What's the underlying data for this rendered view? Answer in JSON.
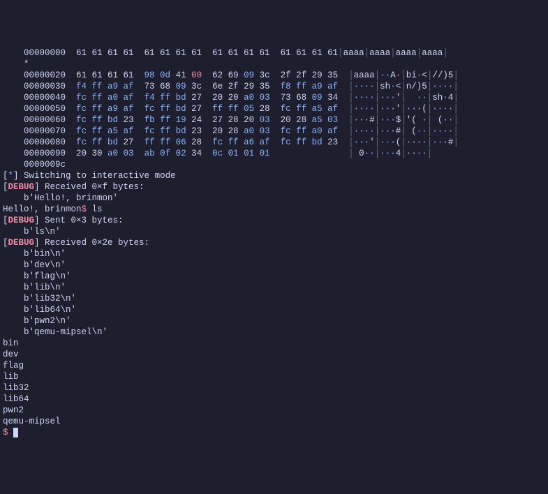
{
  "hex": {
    "rows": [
      {
        "addr": "00000000",
        "spans": [
          {
            "t": "  61 61 61 61  61 61 61 61  61 61 61 61  61 61 61 61",
            "c": "hx"
          }
        ],
        "asc": [
          {
            "t": "│",
            "c": "bar"
          },
          {
            "t": "aaaa",
            "c": "asc"
          },
          {
            "t": "│",
            "c": "bar"
          },
          {
            "t": "aaaa",
            "c": "asc"
          },
          {
            "t": "│",
            "c": "bar"
          },
          {
            "t": "aaaa",
            "c": "asc"
          },
          {
            "t": "│",
            "c": "bar"
          },
          {
            "t": "aaaa",
            "c": "asc"
          },
          {
            "t": "│",
            "c": "bar"
          }
        ]
      },
      {
        "addr": "*",
        "spans": [
          {
            "t": "",
            "c": "hx"
          }
        ],
        "asc": []
      },
      {
        "addr": "00000020",
        "spans": [
          {
            "t": "  61 61 61 61  ",
            "c": "hx"
          },
          {
            "t": "98 0d",
            "c": "c1"
          },
          {
            "t": " 41 ",
            "c": "hx"
          },
          {
            "t": "00",
            "c": "c2"
          },
          {
            "t": "  62 69 ",
            "c": "hx"
          },
          {
            "t": "09",
            "c": "c1"
          },
          {
            "t": " 3c  2f 2f 29 35",
            "c": "hx"
          }
        ],
        "asc": [
          {
            "t": "  │",
            "c": "bar"
          },
          {
            "t": "aaaa",
            "c": "asc"
          },
          {
            "t": "│",
            "c": "bar"
          },
          {
            "t": "··",
            "c": "ascB"
          },
          {
            "t": "A",
            "c": "asc"
          },
          {
            "t": "·",
            "c": "ascR"
          },
          {
            "t": "│",
            "c": "bar"
          },
          {
            "t": "bi",
            "c": "asc"
          },
          {
            "t": "·",
            "c": "ascB"
          },
          {
            "t": "<",
            "c": "asc"
          },
          {
            "t": "│",
            "c": "bar"
          },
          {
            "t": "//)5",
            "c": "asc"
          },
          {
            "t": "│",
            "c": "bar"
          }
        ]
      },
      {
        "addr": "00000030",
        "spans": [
          {
            "t": "  ",
            "c": "hx"
          },
          {
            "t": "f4 ff a9 af",
            "c": "c1"
          },
          {
            "t": "  73 68 ",
            "c": "hx"
          },
          {
            "t": "09",
            "c": "c1"
          },
          {
            "t": " 3c  6e 2f 29 35  ",
            "c": "hx"
          },
          {
            "t": "f8 ff a9 af",
            "c": "c1"
          }
        ],
        "asc": [
          {
            "t": "  │",
            "c": "bar"
          },
          {
            "t": "····",
            "c": "ascB"
          },
          {
            "t": "│",
            "c": "bar"
          },
          {
            "t": "sh",
            "c": "asc"
          },
          {
            "t": "·",
            "c": "ascB"
          },
          {
            "t": "<",
            "c": "asc"
          },
          {
            "t": "│",
            "c": "bar"
          },
          {
            "t": "n/)5",
            "c": "asc"
          },
          {
            "t": "│",
            "c": "bar"
          },
          {
            "t": "····",
            "c": "ascB"
          },
          {
            "t": "│",
            "c": "bar"
          }
        ]
      },
      {
        "addr": "00000040",
        "spans": [
          {
            "t": "  ",
            "c": "hx"
          },
          {
            "t": "fc ff a0 af",
            "c": "c1"
          },
          {
            "t": "  ",
            "c": "hx"
          },
          {
            "t": "f4 ff bd",
            "c": "c1"
          },
          {
            "t": " 27  20 20 ",
            "c": "hx"
          },
          {
            "t": "a0 03",
            "c": "c1"
          },
          {
            "t": "  73 68 ",
            "c": "hx"
          },
          {
            "t": "09",
            "c": "c1"
          },
          {
            "t": " 34",
            "c": "hx"
          }
        ],
        "asc": [
          {
            "t": "  │",
            "c": "bar"
          },
          {
            "t": "····",
            "c": "ascB"
          },
          {
            "t": "│",
            "c": "bar"
          },
          {
            "t": "···",
            "c": "ascB"
          },
          {
            "t": "'",
            "c": "asc"
          },
          {
            "t": "│",
            "c": "bar"
          },
          {
            "t": "  ",
            "c": "asc"
          },
          {
            "t": "··",
            "c": "ascB"
          },
          {
            "t": "│",
            "c": "bar"
          },
          {
            "t": "sh",
            "c": "asc"
          },
          {
            "t": "·",
            "c": "ascB"
          },
          {
            "t": "4",
            "c": "asc"
          },
          {
            "t": "│",
            "c": "bar"
          }
        ]
      },
      {
        "addr": "00000050",
        "spans": [
          {
            "t": "  ",
            "c": "hx"
          },
          {
            "t": "fc ff a9 af",
            "c": "c1"
          },
          {
            "t": "  ",
            "c": "hx"
          },
          {
            "t": "fc ff bd",
            "c": "c1"
          },
          {
            "t": " 27  ",
            "c": "hx"
          },
          {
            "t": "ff ff 05",
            "c": "c1"
          },
          {
            "t": " 28  ",
            "c": "hx"
          },
          {
            "t": "fc ff a5 af",
            "c": "c1"
          }
        ],
        "asc": [
          {
            "t": "  │",
            "c": "bar"
          },
          {
            "t": "····",
            "c": "ascB"
          },
          {
            "t": "│",
            "c": "bar"
          },
          {
            "t": "···",
            "c": "ascB"
          },
          {
            "t": "'",
            "c": "asc"
          },
          {
            "t": "│",
            "c": "bar"
          },
          {
            "t": "···",
            "c": "ascB"
          },
          {
            "t": "(",
            "c": "asc"
          },
          {
            "t": "│",
            "c": "bar"
          },
          {
            "t": "····",
            "c": "ascB"
          },
          {
            "t": "│",
            "c": "bar"
          }
        ]
      },
      {
        "addr": "00000060",
        "spans": [
          {
            "t": "  ",
            "c": "hx"
          },
          {
            "t": "fc ff bd",
            "c": "c1"
          },
          {
            "t": " 23  ",
            "c": "hx"
          },
          {
            "t": "fb ff 19",
            "c": "c1"
          },
          {
            "t": " 24  27 28 20 ",
            "c": "hx"
          },
          {
            "t": "03",
            "c": "c1"
          },
          {
            "t": "  20 28 ",
            "c": "hx"
          },
          {
            "t": "a5 03",
            "c": "c1"
          }
        ],
        "asc": [
          {
            "t": "  │",
            "c": "bar"
          },
          {
            "t": "···",
            "c": "ascB"
          },
          {
            "t": "#",
            "c": "asc"
          },
          {
            "t": "│",
            "c": "bar"
          },
          {
            "t": "···",
            "c": "ascB"
          },
          {
            "t": "$",
            "c": "asc"
          },
          {
            "t": "│",
            "c": "bar"
          },
          {
            "t": "'( ",
            "c": "asc"
          },
          {
            "t": "·",
            "c": "ascB"
          },
          {
            "t": "│",
            "c": "bar"
          },
          {
            "t": " (",
            "c": "asc"
          },
          {
            "t": "··",
            "c": "ascB"
          },
          {
            "t": "│",
            "c": "bar"
          }
        ]
      },
      {
        "addr": "00000070",
        "spans": [
          {
            "t": "  ",
            "c": "hx"
          },
          {
            "t": "fc ff a5 af",
            "c": "c1"
          },
          {
            "t": "  ",
            "c": "hx"
          },
          {
            "t": "fc ff bd",
            "c": "c1"
          },
          {
            "t": " 23  20 28 ",
            "c": "hx"
          },
          {
            "t": "a0 03",
            "c": "c1"
          },
          {
            "t": "  ",
            "c": "hx"
          },
          {
            "t": "fc ff a0 af",
            "c": "c1"
          }
        ],
        "asc": [
          {
            "t": "  │",
            "c": "bar"
          },
          {
            "t": "····",
            "c": "ascB"
          },
          {
            "t": "│",
            "c": "bar"
          },
          {
            "t": "···",
            "c": "ascB"
          },
          {
            "t": "#",
            "c": "asc"
          },
          {
            "t": "│",
            "c": "bar"
          },
          {
            "t": " (",
            "c": "asc"
          },
          {
            "t": "··",
            "c": "ascB"
          },
          {
            "t": "│",
            "c": "bar"
          },
          {
            "t": "····",
            "c": "ascB"
          },
          {
            "t": "│",
            "c": "bar"
          }
        ]
      },
      {
        "addr": "00000080",
        "spans": [
          {
            "t": "  ",
            "c": "hx"
          },
          {
            "t": "fc ff bd",
            "c": "c1"
          },
          {
            "t": " 27  ",
            "c": "hx"
          },
          {
            "t": "ff ff 06",
            "c": "c1"
          },
          {
            "t": " 28  ",
            "c": "hx"
          },
          {
            "t": "fc ff a6 af",
            "c": "c1"
          },
          {
            "t": "  ",
            "c": "hx"
          },
          {
            "t": "fc ff bd",
            "c": "c1"
          },
          {
            "t": " 23",
            "c": "hx"
          }
        ],
        "asc": [
          {
            "t": "  │",
            "c": "bar"
          },
          {
            "t": "···",
            "c": "ascB"
          },
          {
            "t": "'",
            "c": "asc"
          },
          {
            "t": "│",
            "c": "bar"
          },
          {
            "t": "···",
            "c": "ascB"
          },
          {
            "t": "(",
            "c": "asc"
          },
          {
            "t": "│",
            "c": "bar"
          },
          {
            "t": "····",
            "c": "ascB"
          },
          {
            "t": "│",
            "c": "bar"
          },
          {
            "t": "···",
            "c": "ascB"
          },
          {
            "t": "#",
            "c": "asc"
          },
          {
            "t": "│",
            "c": "bar"
          }
        ]
      },
      {
        "addr": "00000090",
        "spans": [
          {
            "t": "  20 30 ",
            "c": "hx"
          },
          {
            "t": "a0 03",
            "c": "c1"
          },
          {
            "t": "  ",
            "c": "hx"
          },
          {
            "t": "ab 0f 02",
            "c": "c1"
          },
          {
            "t": " 34  ",
            "c": "hx"
          },
          {
            "t": "0c 01 01 01",
            "c": "c1"
          }
        ],
        "asc": [
          {
            "t": "               │",
            "c": "bar"
          },
          {
            "t": " 0",
            "c": "asc"
          },
          {
            "t": "··",
            "c": "ascB"
          },
          {
            "t": "│",
            "c": "bar"
          },
          {
            "t": "···",
            "c": "ascB"
          },
          {
            "t": "4",
            "c": "asc"
          },
          {
            "t": "│",
            "c": "bar"
          },
          {
            "t": "····",
            "c": "ascB"
          },
          {
            "t": "│",
            "c": "bar"
          }
        ]
      },
      {
        "addr": "0000009c",
        "spans": [
          {
            "t": "",
            "c": "hx"
          }
        ],
        "asc": []
      }
    ]
  },
  "log": [
    {
      "spans": [
        {
          "t": "[",
          "c": ""
        },
        {
          "t": "*",
          "c": "star"
        },
        {
          "t": "] Switching to interactive mode",
          "c": ""
        }
      ]
    },
    {
      "spans": [
        {
          "t": "[",
          "c": ""
        },
        {
          "t": "DEBUG",
          "c": "dbg"
        },
        {
          "t": "] Received 0×f bytes:",
          "c": ""
        }
      ]
    },
    {
      "spans": [
        {
          "t": "    b'Hello!, brinmon'",
          "c": ""
        }
      ]
    },
    {
      "spans": [
        {
          "t": "Hello!, brinmon",
          "c": ""
        },
        {
          "t": "$",
          "c": "rp"
        },
        {
          "t": " ls",
          "c": ""
        }
      ]
    },
    {
      "spans": [
        {
          "t": "[",
          "c": ""
        },
        {
          "t": "DEBUG",
          "c": "dbg"
        },
        {
          "t": "] Sent 0×3 bytes:",
          "c": ""
        }
      ]
    },
    {
      "spans": [
        {
          "t": "    b'ls\\n'",
          "c": ""
        }
      ]
    },
    {
      "spans": [
        {
          "t": "[",
          "c": ""
        },
        {
          "t": "DEBUG",
          "c": "dbg"
        },
        {
          "t": "] Received 0×2e bytes:",
          "c": ""
        }
      ]
    },
    {
      "spans": [
        {
          "t": "    b'bin\\n'",
          "c": ""
        }
      ]
    },
    {
      "spans": [
        {
          "t": "    b'dev\\n'",
          "c": ""
        }
      ]
    },
    {
      "spans": [
        {
          "t": "    b'flag\\n'",
          "c": ""
        }
      ]
    },
    {
      "spans": [
        {
          "t": "    b'lib\\n'",
          "c": ""
        }
      ]
    },
    {
      "spans": [
        {
          "t": "    b'lib32\\n'",
          "c": ""
        }
      ]
    },
    {
      "spans": [
        {
          "t": "    b'lib64\\n'",
          "c": ""
        }
      ]
    },
    {
      "spans": [
        {
          "t": "    b'pwn2\\n'",
          "c": ""
        }
      ]
    },
    {
      "spans": [
        {
          "t": "    b'qemu-mipsel\\n'",
          "c": ""
        }
      ]
    },
    {
      "spans": [
        {
          "t": "bin",
          "c": ""
        }
      ]
    },
    {
      "spans": [
        {
          "t": "dev",
          "c": ""
        }
      ]
    },
    {
      "spans": [
        {
          "t": "flag",
          "c": ""
        }
      ]
    },
    {
      "spans": [
        {
          "t": "lib",
          "c": ""
        }
      ]
    },
    {
      "spans": [
        {
          "t": "lib32",
          "c": ""
        }
      ]
    },
    {
      "spans": [
        {
          "t": "lib64",
          "c": ""
        }
      ]
    },
    {
      "spans": [
        {
          "t": "pwn2",
          "c": ""
        }
      ]
    },
    {
      "spans": [
        {
          "t": "qemu-mipsel",
          "c": ""
        }
      ]
    }
  ],
  "prompt": "$"
}
